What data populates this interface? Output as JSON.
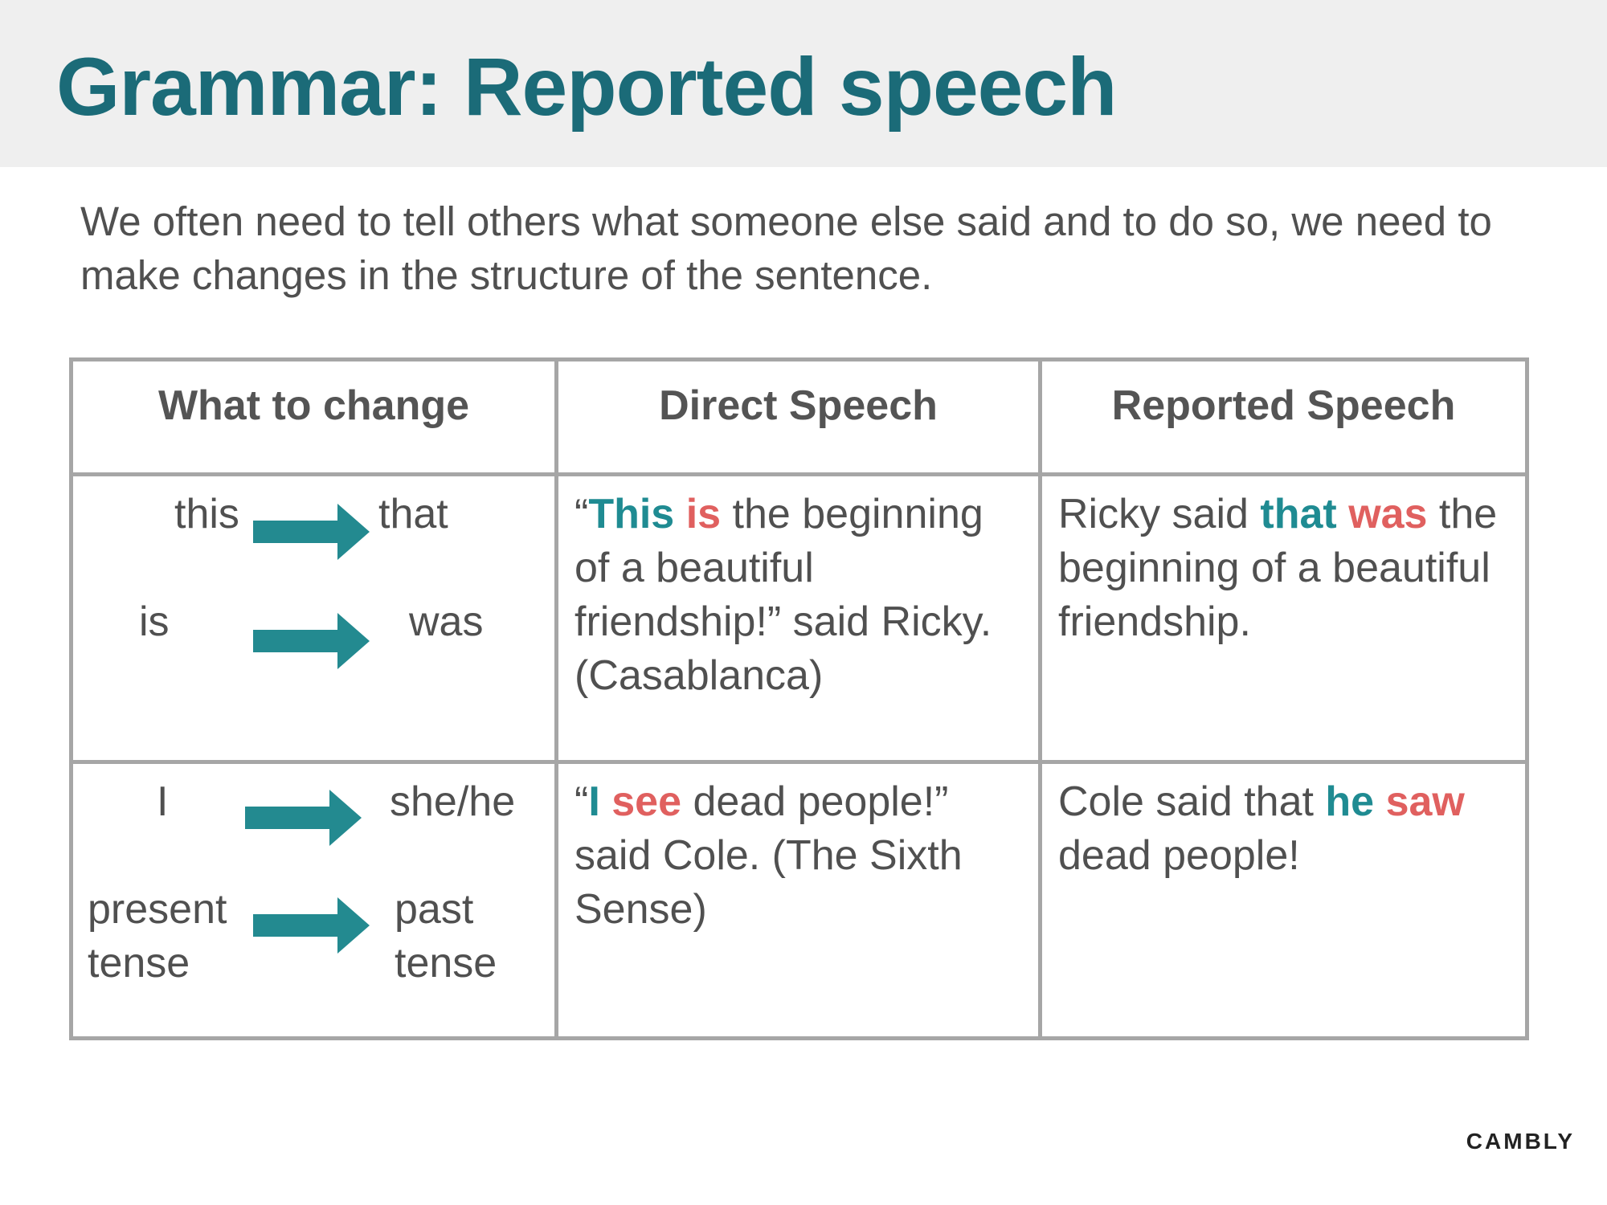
{
  "title": "Grammar: Reported speech",
  "intro": "We often need to tell others what someone else said and to do so, we need to make changes in the structure of the sentence.",
  "table": {
    "headers": [
      "What to change",
      "Direct Speech",
      "Reported Speech"
    ],
    "rows": [
      {
        "changes": [
          {
            "from": "this",
            "to": "that"
          },
          {
            "from": "is",
            "to": "was"
          }
        ],
        "direct": {
          "open_quote": "“",
          "hl1": "This",
          "space": " ",
          "hl2": "is",
          "rest": " the beginning of a beautiful friendship!” said Ricky.  (Casablanca)"
        },
        "reported": {
          "pre": "Ricky said ",
          "hl1": "that",
          "space": " ",
          "hl2": "was",
          "rest": " the beginning of a beautiful friendship."
        }
      },
      {
        "changes": [
          {
            "from": "I",
            "to": "she/he"
          },
          {
            "from": "present tense",
            "to": "past tense"
          }
        ],
        "direct": {
          "open_quote": "“",
          "hl1": "I",
          "space": " ",
          "hl2": "see",
          "rest": " dead people!” said Cole. (The Sixth Sense)"
        },
        "reported": {
          "pre": "Cole said that ",
          "hl1": "he",
          "space": " ",
          "hl2": "saw",
          "rest": " dead people!"
        }
      }
    ]
  },
  "brand": "CAMBLY",
  "colors": {
    "title": "#1b6b78",
    "highlight_teal": "#1f8b92",
    "highlight_red": "#e0605f",
    "arrow": "#238a90",
    "border": "#a6a6a6",
    "title_band": "#efefef"
  },
  "icons": {
    "arrow": "right-arrow-icon"
  }
}
